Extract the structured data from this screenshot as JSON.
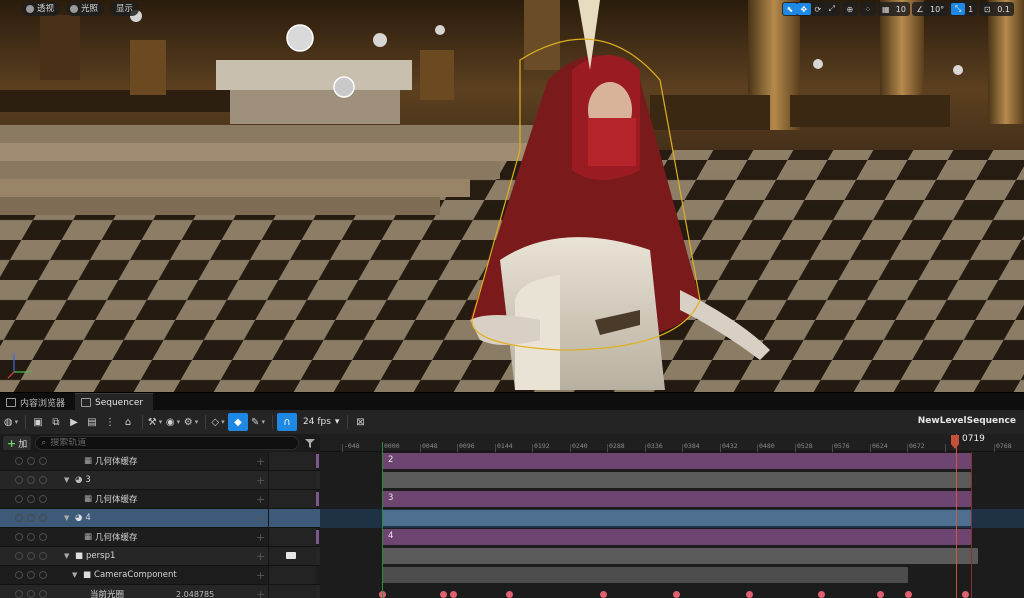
{
  "viewport": {
    "pills": [
      {
        "label": "透视",
        "icon": "perspective-icon"
      },
      {
        "label": "光照",
        "icon": "lit-icon"
      },
      {
        "label": "显示",
        "icon": "show-icon"
      }
    ],
    "toolbar": {
      "grid_snap": "10",
      "rotation_snap": "10°",
      "scale_snap": "0.1",
      "camera_speed": "1"
    }
  },
  "tabs": [
    {
      "label": "内容浏览器",
      "active": false
    },
    {
      "label": "Sequencer",
      "active": true
    }
  ],
  "sequencer": {
    "fps": "24 fps",
    "sequence_name": "NewLevelSequence",
    "add_label": "加",
    "search_placeholder": "搜索轨道",
    "current_frame": "0719",
    "ruler_labels": [
      "-048",
      "0000",
      "0048",
      "0096",
      "0144",
      "0192",
      "0240",
      "0288",
      "0336",
      "0384",
      "0432",
      "0480",
      "0528",
      "0576",
      "0624",
      "0672",
      "0768"
    ],
    "tracks": [
      {
        "label": "几何体缓存",
        "indent": 2,
        "type": "geo",
        "section": "2"
      },
      {
        "label": "3",
        "indent": 1,
        "type": "actor",
        "section": ""
      },
      {
        "label": "几何体缓存",
        "indent": 2,
        "type": "geo",
        "section": "3"
      },
      {
        "label": "4",
        "indent": 1,
        "type": "actor",
        "section": "",
        "selected": true
      },
      {
        "label": "几何体缓存",
        "indent": 2,
        "type": "geo",
        "section": "4"
      },
      {
        "label": "persp1",
        "indent": 1,
        "type": "camera",
        "section": ""
      },
      {
        "label": "CameraComponent",
        "indent": 2,
        "type": "component",
        "section": ""
      },
      {
        "label": "当前光圈",
        "indent": 3,
        "type": "property",
        "value": "2.048785",
        "section": ""
      }
    ]
  },
  "colors": {
    "accent_blue": "#1e88e5",
    "section_purple": "#7a4a7a",
    "section_gray": "#5a5a5a",
    "selection": "#3d5a78",
    "playhead": "#c5503a"
  }
}
